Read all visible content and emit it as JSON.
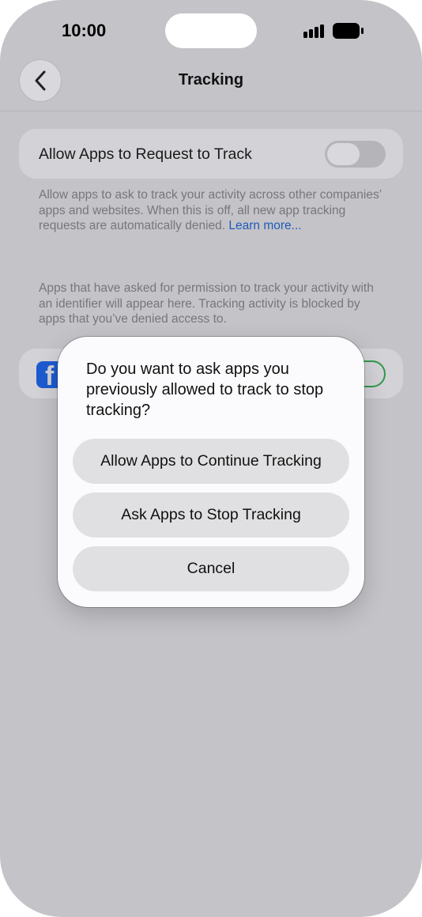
{
  "status_bar": {
    "time": "10:00"
  },
  "nav": {
    "back_icon": "chevron-left-icon",
    "title": "Tracking"
  },
  "settings": {
    "toggle_label": "Allow Apps to Request to Track",
    "toggle_state": "off",
    "description": "Allow apps to ask to track your activity across other companies’ apps and websites. When this is off, all new app tracking requests are automatically denied.",
    "learn_more": "Learn more...",
    "permission_note": "Apps that have asked for permission to track your activity with an identifier will appear here. Tracking activity is blocked by apps that you’ve denied access to."
  },
  "app_list": [
    {
      "icon": "facebook-icon",
      "toggle_state": "on"
    }
  ],
  "alert": {
    "message": "Do you want to ask apps you previously allowed to track to stop tracking?",
    "buttons": [
      "Allow Apps to Continue Tracking",
      "Ask Apps to Stop Tracking",
      "Cancel"
    ]
  },
  "colors": {
    "dimmed_background": "#c4c3c8",
    "link": "#1e5bb8",
    "facebook_brand": "#1c5bd0",
    "switch_on_border": "#2f9a48"
  }
}
